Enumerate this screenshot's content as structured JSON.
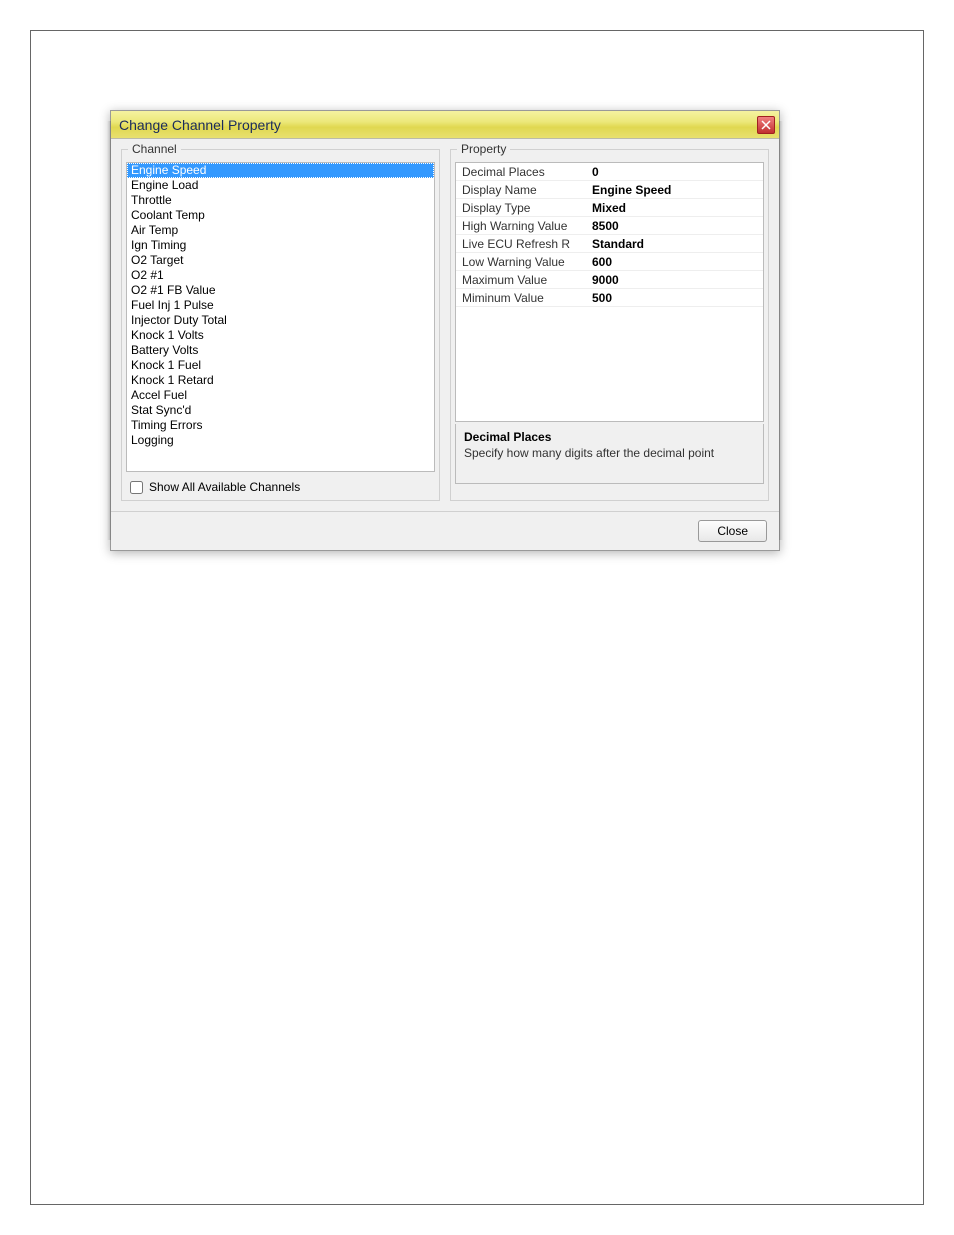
{
  "dialog": {
    "title": "Change Channel Property",
    "close_button_label": "Close"
  },
  "channel_panel": {
    "label": "Channel",
    "items": [
      "Engine Speed",
      "Engine Load",
      "Throttle",
      "Coolant Temp",
      "Air Temp",
      "Ign Timing",
      "O2 Target",
      "O2 #1",
      "O2 #1 FB Value",
      "Fuel Inj 1 Pulse",
      "Injector Duty Total",
      "Knock 1 Volts",
      "Battery Volts",
      "Knock 1 Fuel",
      "Knock 1 Retard",
      "Accel Fuel",
      "Stat Sync'd",
      "Timing Errors",
      "Logging"
    ],
    "selected_index": 0,
    "show_all_label": "Show All Available Channels",
    "show_all_checked": false
  },
  "property_panel": {
    "label": "Property",
    "rows": [
      {
        "label": "Decimal Places",
        "value": "0"
      },
      {
        "label": "Display Name",
        "value": "Engine Speed"
      },
      {
        "label": "Display Type",
        "value": "Mixed"
      },
      {
        "label": "High Warning Value",
        "value": "8500"
      },
      {
        "label": "Live ECU Refresh R",
        "value": "Standard"
      },
      {
        "label": "Low Warning Value",
        "value": "600"
      },
      {
        "label": "Maximum Value",
        "value": "9000"
      },
      {
        "label": "Miminum Value",
        "value": "500"
      }
    ],
    "description": {
      "title": "Decimal Places",
      "text": "Specify how many digits after the decimal point"
    }
  }
}
